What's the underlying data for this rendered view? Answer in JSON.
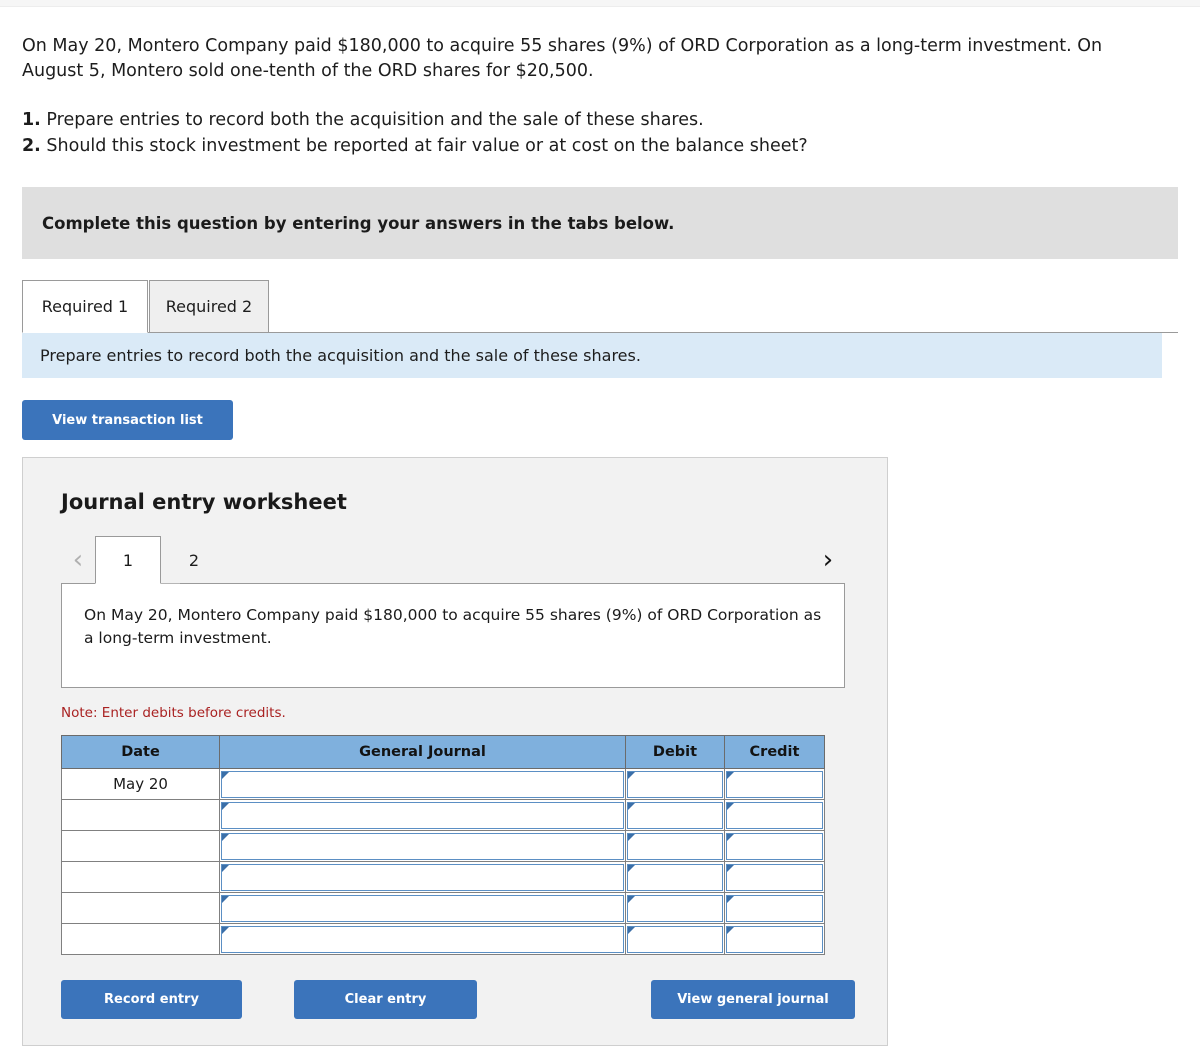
{
  "problem": {
    "statement": "On May 20, Montero Company paid $180,000 to acquire 55 shares (9%) of ORD Corporation as a long-term investment. On August 5, Montero sold one-tenth of the ORD shares for $20,500.",
    "requirements": [
      {
        "num": "1.",
        "text": "Prepare entries to record both the acquisition and the sale of these shares."
      },
      {
        "num": "2.",
        "text": "Should this stock investment be reported at fair value or at cost on the balance sheet?"
      }
    ]
  },
  "instruction_banner": {
    "text": "Complete this question by entering your answers in the tabs below."
  },
  "required_tabs": [
    {
      "label": "Required 1",
      "active": true
    },
    {
      "label": "Required 2",
      "active": false
    }
  ],
  "sub_instruction": {
    "text": "Prepare entries to record both the acquisition and the sale of these shares."
  },
  "view_transaction_button": {
    "label": "View transaction list"
  },
  "worksheet": {
    "title": "Journal entry worksheet",
    "pager": {
      "prev_icon": "chevron-left-icon",
      "prev_glyph": "‹",
      "next_icon": "chevron-right-icon",
      "next_glyph": "›",
      "entries": [
        {
          "label": "1",
          "active": true
        },
        {
          "label": "2",
          "active": false
        }
      ]
    },
    "transaction_description": "On May 20, Montero Company paid $180,000 to acquire 55 shares (9%) of ORD Corporation as a long-term investment.",
    "note": "Note: Enter debits before credits.",
    "table": {
      "headers": [
        "Date",
        "General Journal",
        "Debit",
        "Credit"
      ],
      "rows": [
        {
          "date": "May 20",
          "general_journal": "",
          "debit": "",
          "credit": ""
        },
        {
          "date": "",
          "general_journal": "",
          "debit": "",
          "credit": ""
        },
        {
          "date": "",
          "general_journal": "",
          "debit": "",
          "credit": ""
        },
        {
          "date": "",
          "general_journal": "",
          "debit": "",
          "credit": ""
        },
        {
          "date": "",
          "general_journal": "",
          "debit": "",
          "credit": ""
        },
        {
          "date": "",
          "general_journal": "",
          "debit": "",
          "credit": ""
        }
      ]
    },
    "actions": {
      "record": "Record entry",
      "clear": "Clear entry",
      "view_general_journal": "View general journal"
    }
  },
  "colors": {
    "primary_button": "#3b74bb",
    "table_header": "#7fb0dd",
    "info_banner": "#daeaf7",
    "instruction_banner": "#dfdfdf",
    "panel": "#f2f2f2",
    "note_text": "#a92222"
  }
}
